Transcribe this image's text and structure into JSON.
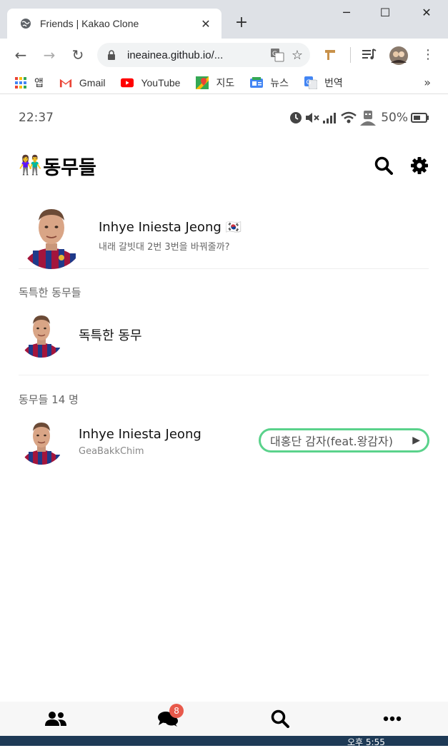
{
  "browser": {
    "tab_title": "Friends | Kakao Clone",
    "url": "ineainea.github.io/...",
    "bookmarks": [
      {
        "label": "앱",
        "icon": "apps-icon"
      },
      {
        "label": "Gmail",
        "icon": "gmail-icon"
      },
      {
        "label": "YouTube",
        "icon": "youtube-icon"
      },
      {
        "label": "지도",
        "icon": "maps-icon"
      },
      {
        "label": "뉴스",
        "icon": "news-icon"
      },
      {
        "label": "번역",
        "icon": "translate-icon"
      }
    ],
    "more": "»"
  },
  "status": {
    "time": "22:37",
    "battery": "50%"
  },
  "header": {
    "title": "동무들",
    "emoji": "👫"
  },
  "me": {
    "name": "Inhye Iniesta Jeong 🇰🇷",
    "message": "내래 갈빗대 2번 3번을 바꿔줄까?"
  },
  "unique": {
    "label": "독특한 동무들",
    "friend_name": "독특한 동무"
  },
  "friends": {
    "label": "동무들 14 명",
    "items": [
      {
        "name": "Inhye Iniesta Jeong",
        "sub": "GeaBakkChim",
        "music": "대홍단 감자(feat.왕감자)"
      }
    ]
  },
  "tabbar": {
    "chat_badge": "8"
  },
  "taskbar": {
    "time": "오후 5:55"
  },
  "colors": {
    "music_border": "#5ad28b",
    "badge": "#e8594b",
    "chrome_bg": "#dee1e6"
  }
}
